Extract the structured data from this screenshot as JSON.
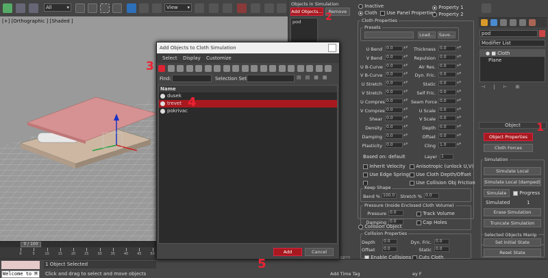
{
  "toolbar": {
    "filter_value": "All",
    "coord_value": "View"
  },
  "viewport": {
    "label": "[+] [Orthographic ] [Shaded ]"
  },
  "timeline": {
    "frame_counter": "0 / 100",
    "ticks": [
      "0",
      "5",
      "10",
      "15",
      "20",
      "25",
      "30",
      "35",
      "40",
      "45",
      "50",
      "55",
      "60",
      "65",
      "70",
      "75",
      "80",
      "85",
      "90",
      "95",
      "100"
    ]
  },
  "status": {
    "listener_text": "Welcome to M",
    "selected_text": "1 Object Selected",
    "hint_text": "Click and drag to select and move objects",
    "add_time_tag": "Add Time Tag",
    "set_key_fragment": "ey F"
  },
  "sim_objects": {
    "title": "Objects in Simulation",
    "add_objects_label": "Add Objects...",
    "remove_label": "Remove",
    "items": [
      "pod"
    ],
    "inactive_label": "Inactive",
    "cloth_label": "Cloth",
    "use_panel_properties_label": "Use Panel Properties",
    "property1_label": "Property 1",
    "property2_label": "Property 2",
    "cancel_fragment": "ncel"
  },
  "cloth_props": {
    "title": "Cloth Properties",
    "presets_label": "Presets",
    "load_label": "Load...",
    "save_label": "Save...",
    "left_params": [
      {
        "label": "U Bend",
        "value": "0.0"
      },
      {
        "label": "V Bend",
        "value": "0.0"
      },
      {
        "label": "U B-Curve",
        "value": "0.0"
      },
      {
        "label": "V B-Curve",
        "value": "0.0"
      },
      {
        "label": "U Stretch",
        "value": "0.0"
      },
      {
        "label": "V Stretch",
        "value": "0.0"
      },
      {
        "label": "U Compress",
        "value": "0.0"
      },
      {
        "label": "V Compress",
        "value": "0.0"
      },
      {
        "label": "Shear",
        "value": "0.0"
      },
      {
        "label": "Density",
        "value": "0.0"
      },
      {
        "label": "Damping",
        "value": "0.0"
      },
      {
        "label": "Plasticity",
        "value": "0.0"
      }
    ],
    "right_params": [
      {
        "label": "Thickness",
        "value": "0.0"
      },
      {
        "label": "Repulsion",
        "value": "0.0"
      },
      {
        "label": "Air Res.",
        "value": "0.0"
      },
      {
        "label": "Dyn. Fric.",
        "value": "0.0"
      },
      {
        "label": "Static",
        "value": "0.0"
      },
      {
        "label": "Self Fric.",
        "value": "0.0"
      },
      {
        "label": "Seam Force",
        "value": "0.0"
      },
      {
        "label": "U Scale",
        "value": "0.0"
      },
      {
        "label": "V Scale",
        "value": "0.0"
      },
      {
        "label": "Depth",
        "value": "0.0"
      },
      {
        "label": "Offset",
        "value": "0.0"
      },
      {
        "label": "Cling",
        "value": "1.0"
      }
    ],
    "based_on": "Based on: default",
    "layer_label": "Layer",
    "layer_value": "1",
    "checkboxes": [
      {
        "label": "Inherit Velocity",
        "checked": false
      },
      {
        "label": "Anisotropic (unlock U,V)",
        "checked": false
      },
      {
        "label": "Use Edge Springs",
        "checked": false
      },
      {
        "label": "Use Cloth Depth/Offset",
        "checked": false
      },
      {
        "label": "",
        "checked": false
      },
      {
        "label": "Use Collision Obj Friction",
        "checked": false
      }
    ],
    "keep_shape": {
      "title": "Keep Shape",
      "bend_label": "Bend %",
      "bend_value": "100.0",
      "stretch_label": "Stretch %",
      "stretch_value": "0.0"
    },
    "pressure": {
      "title": "Pressure (Inside Enclosed Cloth Volume)",
      "pressure_label": "Pressure",
      "pressure_value": "0.0",
      "damping_label": "Damping",
      "damping_value": "0.0",
      "track_volume_label": "Track Volume",
      "cap_holes_label": "Cap Holes"
    },
    "collision_object_label": "Collision Object",
    "collision_props": {
      "title": "Collision Properties",
      "depth_label": "Depth",
      "depth_value": "0.0",
      "offset_label": "Offset",
      "offset_value": "0.0",
      "dyn_fric_label": "Dyn. Fric.",
      "dyn_fric_value": "0.0",
      "static_label": "Static",
      "static_value": "0.0",
      "enable_collisions_label": "Enable Collisions",
      "cuts_cloth_label": "Cuts Cloth"
    }
  },
  "dialog": {
    "title": "Add Objects to Cloth Simulation",
    "menus": [
      "Select",
      "Display",
      "Customize"
    ],
    "find_label": "Find:",
    "selection_set_label": "Selection Set:",
    "column_name": "Name",
    "items": [
      {
        "name": "dusek",
        "highlighted": false
      },
      {
        "name": "trevet",
        "highlighted": true
      },
      {
        "name": "pokrivac",
        "highlighted": false
      }
    ],
    "add_label": "Add",
    "cancel_label": "Cancel"
  },
  "command_panel": {
    "object_name": "pod",
    "modifier_list_label": "Modifier List",
    "stack": [
      "Cloth",
      "Plane"
    ],
    "object_rollout_title": "Object",
    "object_properties_label": "Object Properties",
    "cloth_forces_label": "Cloth Forces",
    "simulation_title": "Simulation",
    "simulate_local_label": "Simulate Local",
    "simulate_local_damped_label": "Simulate Local (damped)",
    "simulate_label": "Simulate",
    "progress_label": "Progress",
    "simulated_label": "Simulated",
    "simulated_value": "1",
    "erase_simulation_label": "Erase Simulation",
    "truncate_simulation_label": "Truncate Simulation",
    "selected_objects_manip_title": "Selected Objects Manip",
    "set_initial_state_label": "Set Initial State",
    "reset_state_label": "Reset State"
  },
  "steps": [
    "1",
    "2",
    "3",
    "4",
    "5"
  ],
  "colors": {
    "accent_red": "#a8191f",
    "step_red": "#e22b33",
    "panel_bg": "#444444",
    "viewport_bg": "#9a9a9a",
    "cloth_pink": "#d48a8a"
  }
}
